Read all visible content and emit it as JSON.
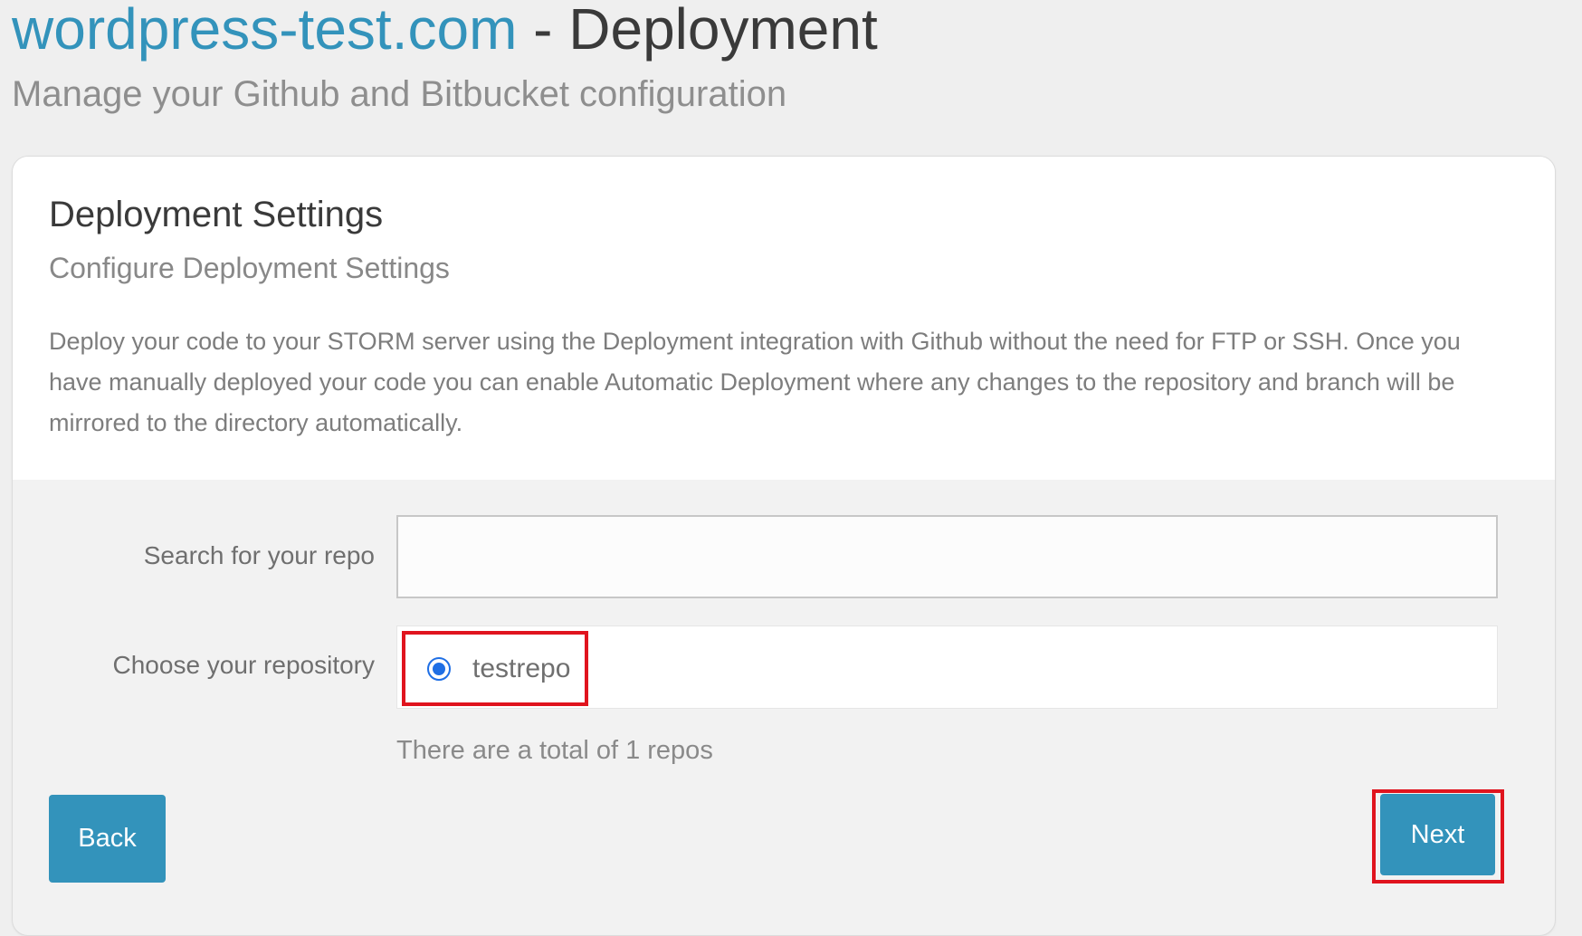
{
  "header": {
    "site_name": "wordpress-test.com",
    "title_separator": " - ",
    "title_section": "Deployment",
    "subtitle": "Manage your Github and Bitbucket configuration"
  },
  "card": {
    "title": "Deployment Settings",
    "subtitle": "Configure Deployment Settings",
    "description": "Deploy your code to your STORM server using the Deployment integration with Github without the need for FTP or SSH. Once you have manually deployed your code you can enable Automatic Deployment where any changes to the repository and branch will be mirrored to the directory automatically."
  },
  "form": {
    "search_label": "Search for your repo",
    "search_value": "",
    "search_placeholder": "",
    "repo_label": "Choose your repository",
    "repos": [
      {
        "name": "testrepo",
        "selected": true
      }
    ],
    "repo_count_text": "There are a total of 1 repos"
  },
  "actions": {
    "back_label": "Back",
    "next_label": "Next"
  },
  "colors": {
    "accent": "#3393bb",
    "highlight": "#e0141e",
    "radio": "#1f6fe5"
  },
  "icons": {
    "radio": "radio-selected-icon"
  }
}
